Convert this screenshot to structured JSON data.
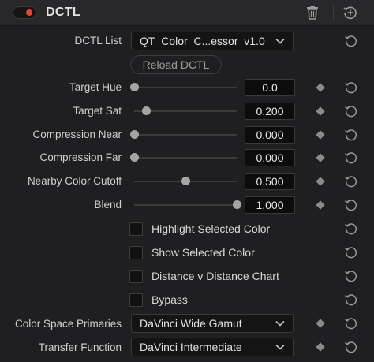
{
  "header": {
    "title": "DCTL",
    "enabled": true,
    "toggle_color": "#e8423a",
    "icons": [
      "trash-icon",
      "add-keyframe-icon"
    ]
  },
  "dctl_list": {
    "label": "DCTL List",
    "value": "QT_Color_C...essor_v1.0"
  },
  "reload_button": {
    "label": "Reload DCTL"
  },
  "sliders": [
    {
      "id": "target-hue",
      "label": "Target Hue",
      "value": "0.0",
      "level": 0.0
    },
    {
      "id": "target-sat",
      "label": "Target Sat",
      "value": "0.200",
      "level": 0.12
    },
    {
      "id": "compression-near",
      "label": "Compression Near",
      "value": "0.000",
      "level": 0.0
    },
    {
      "id": "compression-far",
      "label": "Compression Far",
      "value": "0.000",
      "level": 0.0
    },
    {
      "id": "nearby-color-cutoff",
      "label": "Nearby Color Cutoff",
      "value": "0.500",
      "level": 0.5
    },
    {
      "id": "blend",
      "label": "Blend",
      "value": "1.000",
      "level": 1.0
    }
  ],
  "checkboxes": [
    {
      "id": "highlight-selected-color",
      "label": "Highlight Selected Color",
      "checked": false
    },
    {
      "id": "show-selected-color",
      "label": "Show Selected Color",
      "checked": false
    },
    {
      "id": "distance-v-distance-chart",
      "label": "Distance v Distance Chart",
      "checked": false
    },
    {
      "id": "bypass",
      "label": "Bypass",
      "checked": false
    }
  ],
  "color_space_primaries": {
    "label": "Color Space Primaries",
    "value": "DaVinci Wide Gamut"
  },
  "transfer_function": {
    "label": "Transfer Function",
    "value": "DaVinci Intermediate"
  }
}
